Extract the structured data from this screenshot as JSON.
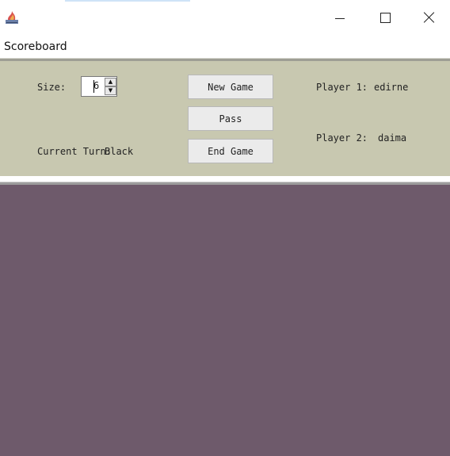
{
  "window": {
    "icon": "java-app-icon",
    "controls": {
      "minimize": "minimize-icon",
      "maximize": "maximize-icon",
      "close": "close-icon"
    }
  },
  "menu": {
    "items": [
      "Scoreboard"
    ]
  },
  "scoreboard": {
    "size_label": "Size:",
    "size_value": "6",
    "current_turn_label": "Current Turn:",
    "current_turn_value": "Black",
    "buttons": {
      "new_game": "New Game",
      "pass": "Pass",
      "end_game": "End Game"
    },
    "player1_label": "Player 1:",
    "player1_name": "edirne",
    "player2_label": "Player 2:",
    "player2_name": "daima"
  },
  "colors": {
    "panel_bg": "#c8c8b0",
    "board_bg": "#6e5a6b"
  }
}
